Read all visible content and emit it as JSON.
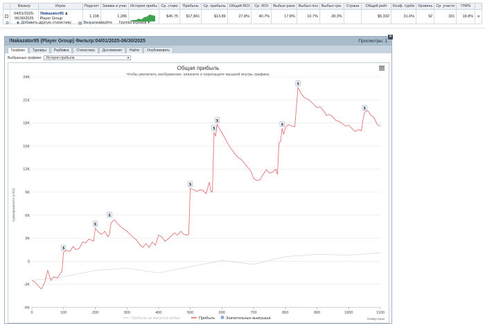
{
  "table": {
    "headers": [
      "Фильтр",
      "Игрок",
      "Подсчет",
      "Заявки и учас",
      "История прибы",
      "Ср. ставо",
      "Прибыль",
      "Ср. прибыль",
      "Общий ROI",
      "Ср. ROI",
      "Выбыл рано",
      "Выбыл поз",
      "Выбыл сре.",
      "Страна",
      "Общий рейт",
      "Коэф. турби",
      "Уровень",
      "Ср. участн",
      "ITM%"
    ],
    "row": {
      "filter": "04/01/2025-06/30/2025",
      "player": "!Nakazator95",
      "group": "Player Group",
      "count": "1,108",
      "entries": "1,286",
      "avg_stake": "$45.75",
      "profit": "$17,861",
      "avg_profit": "$13.89",
      "total_roi": "27.8%",
      "avg_roi": "40.7%",
      "early": "17.8%",
      "late": "10.7%",
      "mid": "28.3%",
      "country": "",
      "total_rating": "$5,332",
      "turbo": "31.6%",
      "level": "92",
      "avg_field": "331",
      "itm": "18.8%"
    }
  },
  "toolbar": {
    "add_stat": "Добавить другую статистику",
    "visualize": "Визуализируйте",
    "groups": "Группы игроков"
  },
  "panel": {
    "title": "!Nakazator95 (Player Group) Фильтр:04/01/2025-06/30/2025",
    "views": "Просмотры: 1",
    "tabs": [
      "Графики",
      "Турниры",
      "Разбивка",
      "Статистика",
      "Достижения",
      "Найти",
      "Опубликовать"
    ],
    "filter_label": "Выбранные графики:",
    "filter_value": "История прибыли"
  },
  "chart_data": {
    "type": "line",
    "title": "Общая прибыль",
    "subtitle": "Чтобы увеличить изображение, кликните и перетащите мышкой внутрь графика.",
    "xlabel": "Номер игры",
    "ylabel": "Суммарный итог (USD)",
    "xlim": [
      0,
      1100
    ],
    "ylim": [
      -6000,
      24000
    ],
    "x_ticks": [
      "0",
      "100",
      "200",
      "300",
      "400",
      "500",
      "600",
      "700",
      "800",
      "900",
      "1000",
      "1100"
    ],
    "y_ticks": [
      "-6K",
      "-3K",
      "0",
      "3K",
      "6K",
      "9K",
      "12K",
      "15K",
      "18K",
      "21K",
      "24K"
    ],
    "legend": [
      "Прибыль за минусом рейка",
      "Прибыль",
      "Значительные выигрыши"
    ],
    "series": [
      {
        "name": "Прибыль",
        "color": "#e06464",
        "points": [
          [
            0,
            -2500
          ],
          [
            10,
            -2700
          ],
          [
            20,
            -3200
          ],
          [
            30,
            -3600
          ],
          [
            40,
            -2800
          ],
          [
            50,
            -1200
          ],
          [
            60,
            -2500
          ],
          [
            70,
            -2000
          ],
          [
            80,
            -2200
          ],
          [
            95,
            -1300
          ],
          [
            100,
            1200
          ],
          [
            110,
            1400
          ],
          [
            120,
            1300
          ],
          [
            130,
            1900
          ],
          [
            140,
            1500
          ],
          [
            150,
            1700
          ],
          [
            160,
            2500
          ],
          [
            170,
            2400
          ],
          [
            180,
            2900
          ],
          [
            190,
            2700
          ],
          [
            195,
            2600
          ],
          [
            200,
            4300
          ],
          [
            210,
            3800
          ],
          [
            220,
            3500
          ],
          [
            230,
            3900
          ],
          [
            240,
            3200
          ],
          [
            245,
            3500
          ],
          [
            250,
            5000
          ],
          [
            260,
            5400
          ],
          [
            270,
            4900
          ],
          [
            280,
            4500
          ],
          [
            290,
            4200
          ],
          [
            300,
            3900
          ],
          [
            310,
            3500
          ],
          [
            320,
            3100
          ],
          [
            330,
            2800
          ],
          [
            340,
            2200
          ],
          [
            350,
            1800
          ],
          [
            360,
            2300
          ],
          [
            370,
            1800
          ],
          [
            380,
            2500
          ],
          [
            390,
            2100
          ],
          [
            400,
            3400
          ],
          [
            410,
            3200
          ],
          [
            420,
            2600
          ],
          [
            430,
            2900
          ],
          [
            440,
            3300
          ],
          [
            450,
            3700
          ],
          [
            460,
            3400
          ],
          [
            470,
            3900
          ],
          [
            480,
            3500
          ],
          [
            490,
            3400
          ],
          [
            495,
            3500
          ],
          [
            500,
            9500
          ],
          [
            510,
            9300
          ],
          [
            520,
            9100
          ],
          [
            530,
            9300
          ],
          [
            540,
            9200
          ],
          [
            550,
            8800
          ],
          [
            560,
            10300
          ],
          [
            565,
            9000
          ],
          [
            570,
            9100
          ],
          [
            575,
            16800
          ],
          [
            580,
            16300
          ],
          [
            585,
            17800
          ],
          [
            590,
            17400
          ],
          [
            600,
            16700
          ],
          [
            610,
            16000
          ],
          [
            620,
            15200
          ],
          [
            630,
            14600
          ],
          [
            640,
            14000
          ],
          [
            650,
            13500
          ],
          [
            660,
            13300
          ],
          [
            670,
            12800
          ],
          [
            680,
            12300
          ],
          [
            690,
            11800
          ],
          [
            700,
            10800
          ],
          [
            710,
            10500
          ],
          [
            720,
            10600
          ],
          [
            730,
            11300
          ],
          [
            740,
            11900
          ],
          [
            750,
            11500
          ],
          [
            760,
            11600
          ],
          [
            770,
            12000
          ],
          [
            775,
            11300
          ],
          [
            780,
            15400
          ],
          [
            785,
            15600
          ],
          [
            790,
            17300
          ],
          [
            795,
            16500
          ],
          [
            800,
            17400
          ],
          [
            810,
            17800
          ],
          [
            820,
            17600
          ],
          [
            830,
            17500
          ],
          [
            840,
            22600
          ],
          [
            850,
            21800
          ],
          [
            860,
            21300
          ],
          [
            870,
            21100
          ],
          [
            880,
            20800
          ],
          [
            890,
            20400
          ],
          [
            900,
            20000
          ],
          [
            910,
            20100
          ],
          [
            920,
            19600
          ],
          [
            930,
            19000
          ],
          [
            940,
            19100
          ],
          [
            950,
            18800
          ],
          [
            960,
            18300
          ],
          [
            970,
            18200
          ],
          [
            980,
            17900
          ],
          [
            990,
            17600
          ],
          [
            1000,
            17700
          ],
          [
            1010,
            17300
          ],
          [
            1020,
            16900
          ],
          [
            1030,
            17100
          ],
          [
            1040,
            17000
          ],
          [
            1045,
            18300
          ],
          [
            1050,
            19400
          ],
          [
            1060,
            19600
          ],
          [
            1070,
            19000
          ],
          [
            1080,
            18700
          ],
          [
            1090,
            17800
          ],
          [
            1100,
            17600
          ]
        ]
      },
      {
        "name": "Прибыль за минусом рейка",
        "color": "#d7dbe0",
        "points": [
          [
            0,
            -2500
          ],
          [
            100,
            -2000
          ],
          [
            200,
            -1200
          ],
          [
            300,
            -900
          ],
          [
            400,
            -1500
          ],
          [
            500,
            -700
          ],
          [
            600,
            100
          ],
          [
            700,
            -400
          ],
          [
            800,
            600
          ],
          [
            900,
            900
          ],
          [
            1000,
            800
          ],
          [
            1100,
            1100
          ]
        ]
      }
    ],
    "big_wins": [
      [
        100,
        1200
      ],
      [
        200,
        4300
      ],
      [
        245,
        5500
      ],
      [
        500,
        9500
      ],
      [
        575,
        16800
      ],
      [
        585,
        17800
      ],
      [
        790,
        17300
      ],
      [
        840,
        22600
      ],
      [
        1050,
        19400
      ]
    ]
  }
}
